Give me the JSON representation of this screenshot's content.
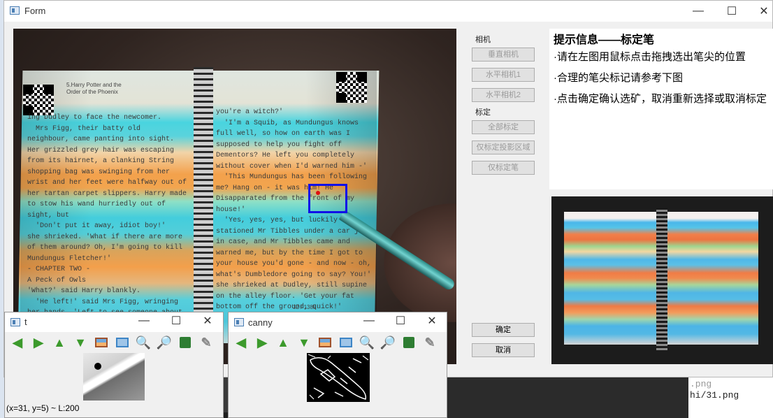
{
  "form": {
    "title": "Form",
    "controls": {
      "minimize": "—",
      "maximize": "☐",
      "close": "✕"
    },
    "book_heading": "5.Harry Potter and the\nOrder of the Phoenix",
    "book_left_text": "ing Dudley to face the newcomer.\n  Mrs Figg, their batty old\nneighbour, came panting into sight.\nHer grizzled grey hair was escaping\nfrom its hairnet, a clanking String\nshopping bag was swinging from her\nwrist and her feet were halfway out of\nher tartan carpet slippers. Harry made\nto stow his wand hurriedly out of\nsight, but\n  'Don't put it away, idiot boy!'\nshe shrieked. 'What if there are more\nof them around? Oh, I'm going to kill\nMundungus Fletcher!'\n- CHAPTER TWO -\nA Peck of Owls\n'What?' said Harry blankly.\n  'He left!' said Mrs Figg, wringing\nher hands. 'Left to see someone about\na batch of cauldrons that fell off the\nback of a broom! I told him I'd flay\nhim alive if he went, and now look!",
    "book_right_text": "you're a witch?'\n  'I'm a Squib, as Mundungus knows\nfull well, so how on earth was I\nsupposed to help you fight off\nDementors? He left you completely\nwithout cover when I'd warned him -'\n  'This Mundungus has been following\nme? Hang on - it was him! He\nDisapparated from the front of my\nhouse!'\n  'Yes, yes, yes, but luckily I'd\nstationed Mr Tibbles under a car just\nin case, and Mr Tibbles came and\nwarned me, but by the time I got to\nyour house you'd gone - and now - oh,\nwhat's Dumbledore going to say? You!'\nshe shrieked at Dudley, still supine\non the alley floor. 'Get your fat\nbottom off the ground, quick!'\n  'You know Dumbledore?' said Harry,\nstaring at her.\n  'Of course I know Dumbledore, who",
    "page_number": "32 / 1385",
    "camera_group_label": "相机",
    "calib_group_label": "标定",
    "buttons": {
      "vertical_camera": "垂直相机",
      "horizontal_camera1": "水平相机1",
      "horizontal_camera2": "水平相机2",
      "calibrate_all": "全部标定",
      "calibrate_projection": "仅标定投影区域",
      "calibrate_pen": "仅标定笔",
      "confirm": "确定",
      "cancel": "取消"
    },
    "info": {
      "title": "提示信息——标定笔",
      "lines": [
        "·请在左图用鼠标点击拖拽选出笔尖的位置",
        "·合理的笔尖标记请参考下图",
        "·点击确定确认选矿，取消重新选择或取消标定"
      ]
    }
  },
  "window_t": {
    "title": "t",
    "status": "(x=31, y=5) ~ L:200",
    "controls": {
      "minimize": "—",
      "maximize": "☐",
      "close": "✕"
    }
  },
  "window_canny": {
    "title": "canny",
    "controls": {
      "minimize": "—",
      "maximize": "☐",
      "close": "✕"
    }
  },
  "toolbar_icons": [
    "arrow-left-icon",
    "arrow-right-icon",
    "arrow-up-icon",
    "arrow-down-icon",
    "save-image-icon",
    "fit-image-icon",
    "zoom-in-icon",
    "zoom-out-icon",
    "save-disk-icon",
    "brush-icon"
  ],
  "background": {
    "terminal_lines": [
      "hi/31.png"
    ]
  },
  "colors": {
    "selection_box": "#1010e8",
    "selection_point": "#e01010",
    "toolbar_green": "#3c9a2c"
  }
}
